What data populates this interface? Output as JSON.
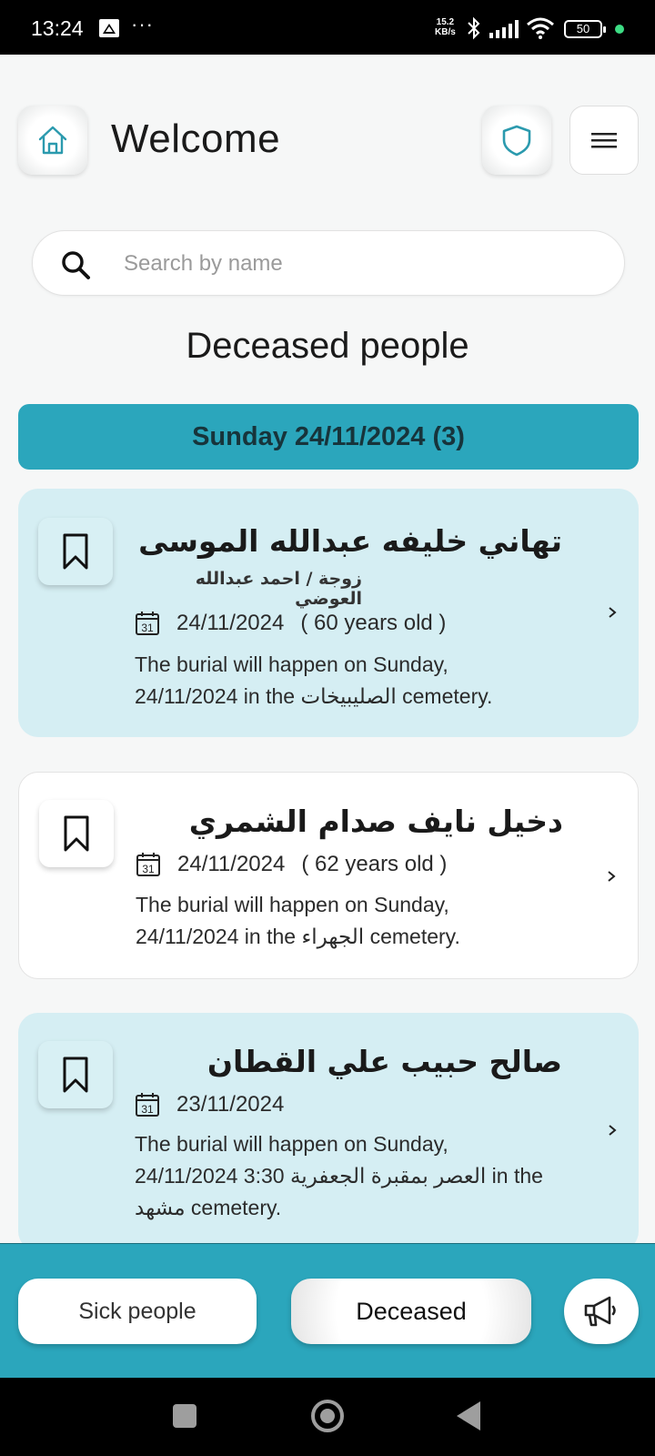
{
  "status_bar": {
    "time": "13:24",
    "dots": "···",
    "speed_value": "15.2",
    "speed_unit": "KB/s",
    "battery": "50"
  },
  "header": {
    "title": "Welcome",
    "home_icon": "home-icon",
    "shield_icon": "shield-icon",
    "menu_icon": "hamburger-menu-icon"
  },
  "search": {
    "placeholder": "Search by name",
    "value": ""
  },
  "section_title": "Deceased people",
  "day_group": {
    "label": "Sunday 24/11/2024 (3)"
  },
  "cards": [
    {
      "name": "تهاني خليفه عبدالله الموسى",
      "relation": "زوجة / احمد عبدالله العوضي",
      "date": "24/11/2024",
      "age": "( 60 years old )",
      "burial_line1": "The burial will happen on Sunday,",
      "burial_line2": "24/11/2024 in the الصليبيخات cemetery.",
      "burial_line3": ""
    },
    {
      "name": "دخيل نايف صدام الشمري",
      "relation": "",
      "date": "24/11/2024",
      "age": "( 62 years old )",
      "burial_line1": "The burial will happen on Sunday,",
      "burial_line2": "24/11/2024 in the الجهراء cemetery.",
      "burial_line3": ""
    },
    {
      "name": "صالح حبيب علي القطان",
      "relation": "",
      "date": "23/11/2024",
      "age": "",
      "burial_line1": "The burial will happen on Sunday,",
      "burial_line2": "24/11/2024 3:30 العصر بمقبرة الجعفرية in the",
      "burial_line3": "مشهد cemetery."
    }
  ],
  "calendar_icon_text": "31",
  "bottom_nav": {
    "sick_label": "Sick people",
    "deceased_label": "Deceased",
    "announce_icon": "megaphone-icon"
  },
  "colors": {
    "accent": "#2ba6bc",
    "card_tint": "#d5eef3",
    "icon_teal": "#2b9aae"
  }
}
